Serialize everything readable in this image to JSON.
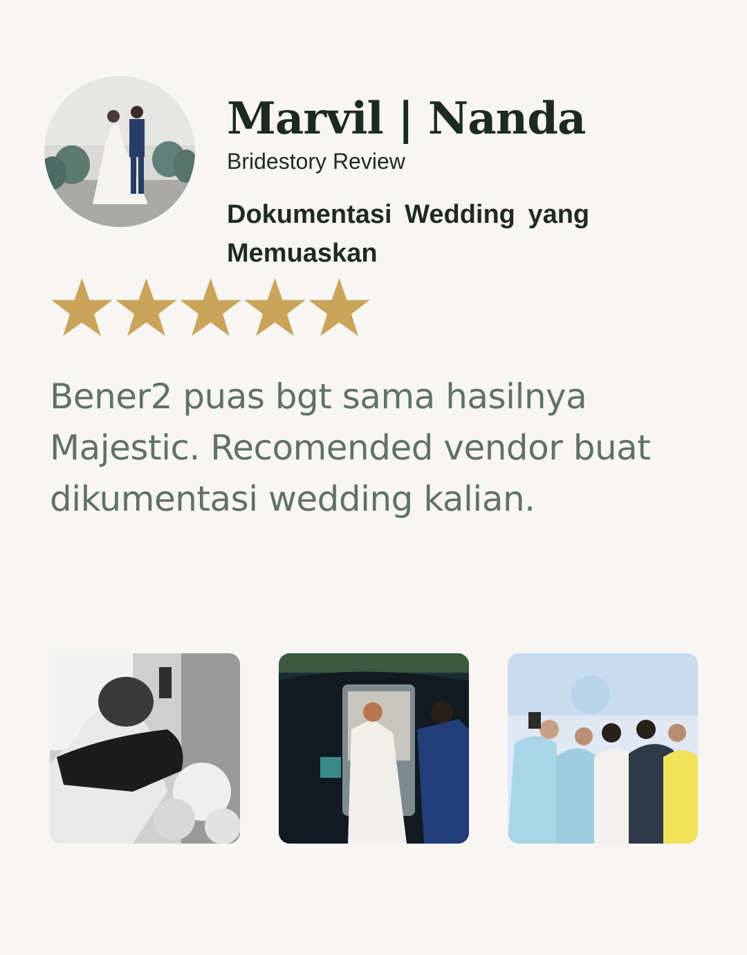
{
  "reviewer": {
    "name": "Marvil | Nanda",
    "source": "Bridestory Review",
    "avatar_icon": "couple-photo"
  },
  "review": {
    "headline": "Dokumentasi Wedding yang Memuaskan",
    "rating": 5,
    "rating_max": 5,
    "star_color": "#c9a45a",
    "text": "Bener2 puas bgt sama hasilnya Majestic. Recomended vendor buat dikumentasi wedding kalian."
  },
  "gallery": [
    {
      "icon": "embrace-photo-bw"
    },
    {
      "icon": "bride-car-photo"
    },
    {
      "icon": "group-selfie-photo"
    }
  ]
}
